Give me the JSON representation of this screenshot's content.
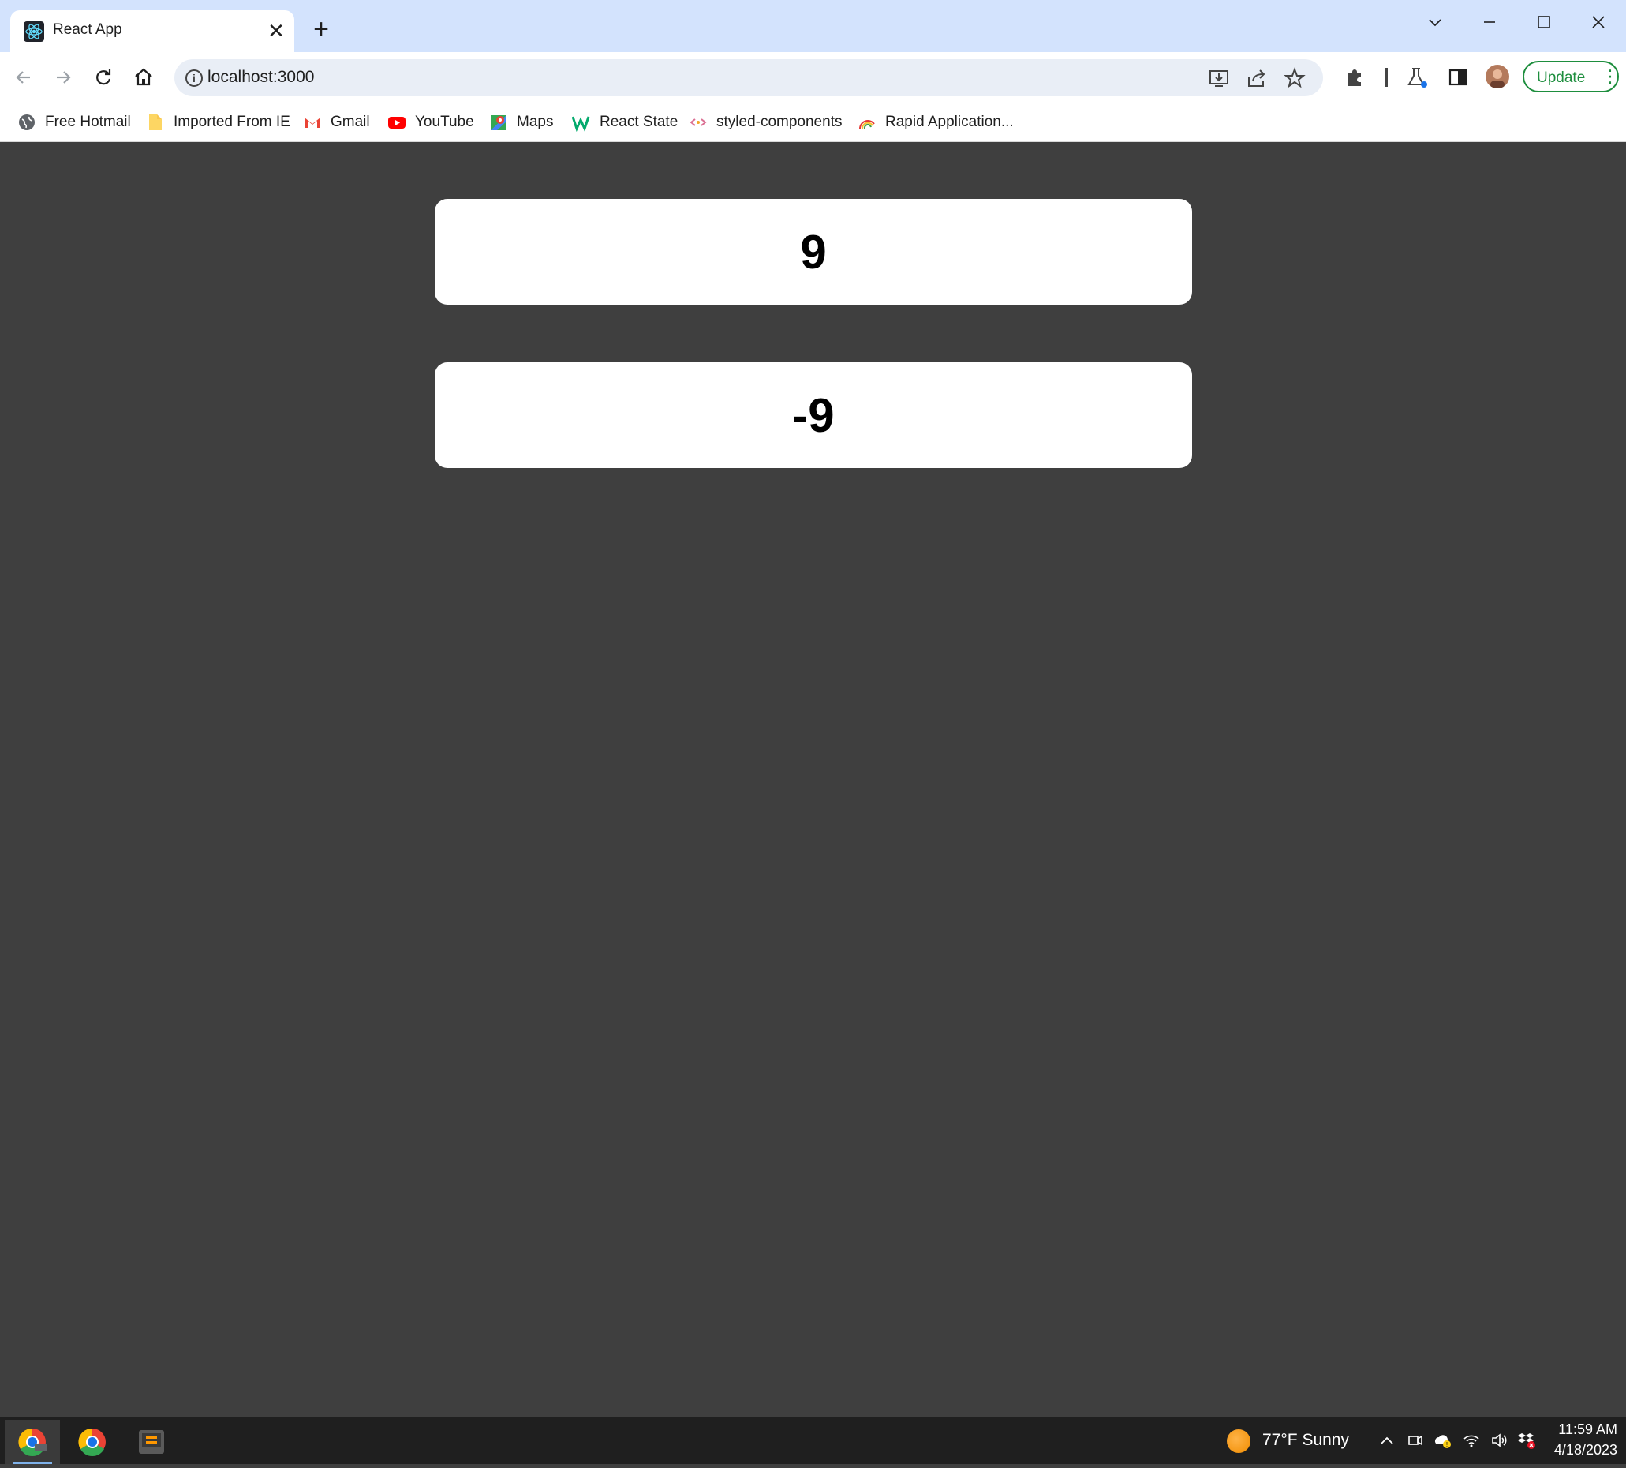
{
  "tab": {
    "title": "React App",
    "close_glyph": "✕"
  },
  "new_tab_glyph": "+",
  "omnibox": {
    "url": "localhost:3000"
  },
  "toolbar": {
    "update_label": "Update"
  },
  "bookmarks": [
    {
      "label": "Free Hotmail",
      "icon": "globe-icon"
    },
    {
      "label": "Imported From IE",
      "icon": "folder-icon"
    },
    {
      "label": "Gmail",
      "icon": "gmail-icon"
    },
    {
      "label": "YouTube",
      "icon": "youtube-icon"
    },
    {
      "label": "Maps",
      "icon": "maps-icon"
    },
    {
      "label": "React State",
      "icon": "w3-icon"
    },
    {
      "label": "styled-components",
      "icon": "styled-components-icon"
    },
    {
      "label": "Rapid Application...",
      "icon": "rainbow-icon"
    }
  ],
  "content": {
    "cards": [
      {
        "value": "9"
      },
      {
        "value": "-9"
      }
    ]
  },
  "taskbar": {
    "weather": {
      "temp": "77°F",
      "condition": "Sunny"
    },
    "clock": {
      "time": "11:59 AM",
      "date": "4/18/2023"
    }
  },
  "colors": {
    "titlebar": "#d3e3fd",
    "page_background": "#3f3f3f",
    "card_background": "#ffffff",
    "update_accent": "#1e8e3e",
    "taskbar": "#1f1f1f"
  }
}
